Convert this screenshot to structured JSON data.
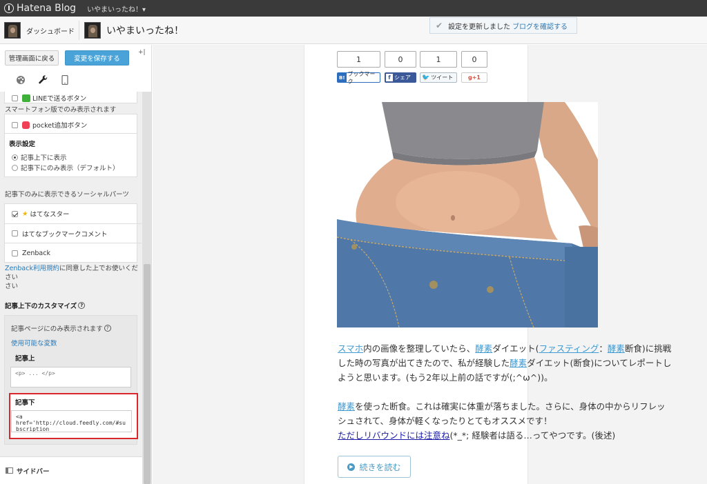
{
  "topbar": {
    "brand": "Hatena Blog",
    "blog_switcher": "いやまいったね！▾"
  },
  "subbar": {
    "dashboard": "ダッシュボード",
    "blog_title": "いやまいったね！"
  },
  "notice": {
    "text": "設定を更新しました",
    "link": "ブログを確認する"
  },
  "sidebar": {
    "back_button": "管理画面に戻る",
    "save_button": "変更を保存する",
    "collapse": "+|",
    "line_button": "LINEで送るボタン",
    "smartphone_only": "スマートフォン版でのみ表示されます",
    "pocket_button": "pocket追加ボタン",
    "display_settings_title": "表示設定",
    "display_options": [
      "記事上下に表示",
      "記事下にのみ表示（デフォルト）"
    ],
    "social_parts_title": "記事下のみに表示できるソーシャルパーツ",
    "hatena_star": "はてなスター",
    "hatena_bookmark_comment": "はてなブックマークコメント",
    "zenback": "Zenback",
    "zenback_terms_link": "Zenback利用規約",
    "zenback_terms_text": "に同意した上でお使いください",
    "zenback_terms_line2": "さい",
    "customize_title": "記事上下のカスタマイズ",
    "article_page_only": "記事ページにのみ表示されます",
    "variables_link": "使用可能な変数",
    "above_label": "記事上",
    "above_placeholder": "<p> ... </p>",
    "below_label": "記事下",
    "below_value": "<a href='http://cloud.feedly.com/#subscription\n<style>",
    "sidebar_section": "サイドバー"
  },
  "share": {
    "counts": [
      "1",
      "0",
      "1",
      "0"
    ],
    "hatebu": "ブックマーク",
    "facebook": "シェア",
    "twitter": "ツイート",
    "gplus": "g+1"
  },
  "article": {
    "p1_l1_a": "スマホ",
    "p1_l1_b": "内の画像を整理していたら、",
    "p1_l1_c": "酵素",
    "p1_l1_d": "ダイエット(",
    "p1_l1_e": "ファスティング",
    "p1_l1_f": "：",
    "p1_l1_g": "酵素",
    "p1_l1_h": "断食)に挑戦",
    "p1_l2_a": "した時の写真が出てきたので、私が経験した",
    "p1_l2_b": "酵素",
    "p1_l2_c": "ダイエット(断食)についてレポートし",
    "p1_l3": "ようと思います。(もう2年以上前の話ですが(;^ω^))。",
    "p2_l1_a": "酵素",
    "p2_l1_b": "を使った断食。これは確実に体重が落ちました。さらに、身体の中からリフレッ",
    "p2_l2": "シュされて、身体が軽くなったりとてもオススメです！",
    "p2_l3_link": "ただしリバウンドには注意ね",
    "p2_l3_rest": "(*_*; 経験者は語る…ってやつです。(後述)",
    "read_more": "続きを読む"
  }
}
